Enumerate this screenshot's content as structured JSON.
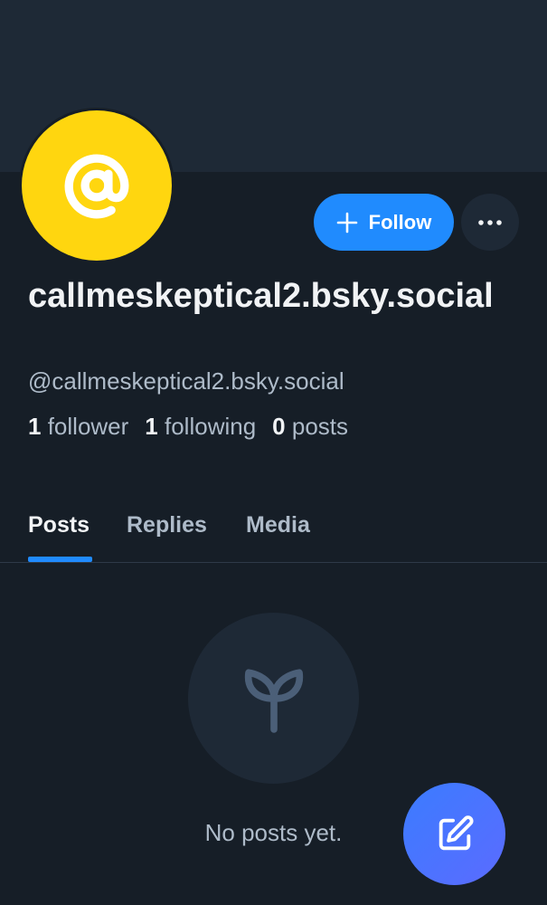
{
  "profile": {
    "display_name": "callmeskeptical2.bsky.social",
    "handle": "@callmeskeptical2.bsky.social",
    "avatar_icon": "at-sign-icon",
    "avatar_color": "#ffd60f"
  },
  "actions": {
    "follow_label": "Follow",
    "follow_icon": "plus-icon",
    "more_icon": "ellipsis-icon"
  },
  "stats": {
    "followers_count": "1",
    "followers_label": "follower",
    "following_count": "1",
    "following_label": "following",
    "posts_count": "0",
    "posts_label": "posts"
  },
  "tabs": [
    {
      "label": "Posts",
      "active": true
    },
    {
      "label": "Replies",
      "active": false
    },
    {
      "label": "Media",
      "active": false
    }
  ],
  "empty_state": {
    "icon": "seedling-icon",
    "message": "No posts yet."
  },
  "fab": {
    "icon": "compose-icon"
  },
  "colors": {
    "background": "#161e27",
    "banner": "#1e2936",
    "accent": "#208bfe"
  }
}
